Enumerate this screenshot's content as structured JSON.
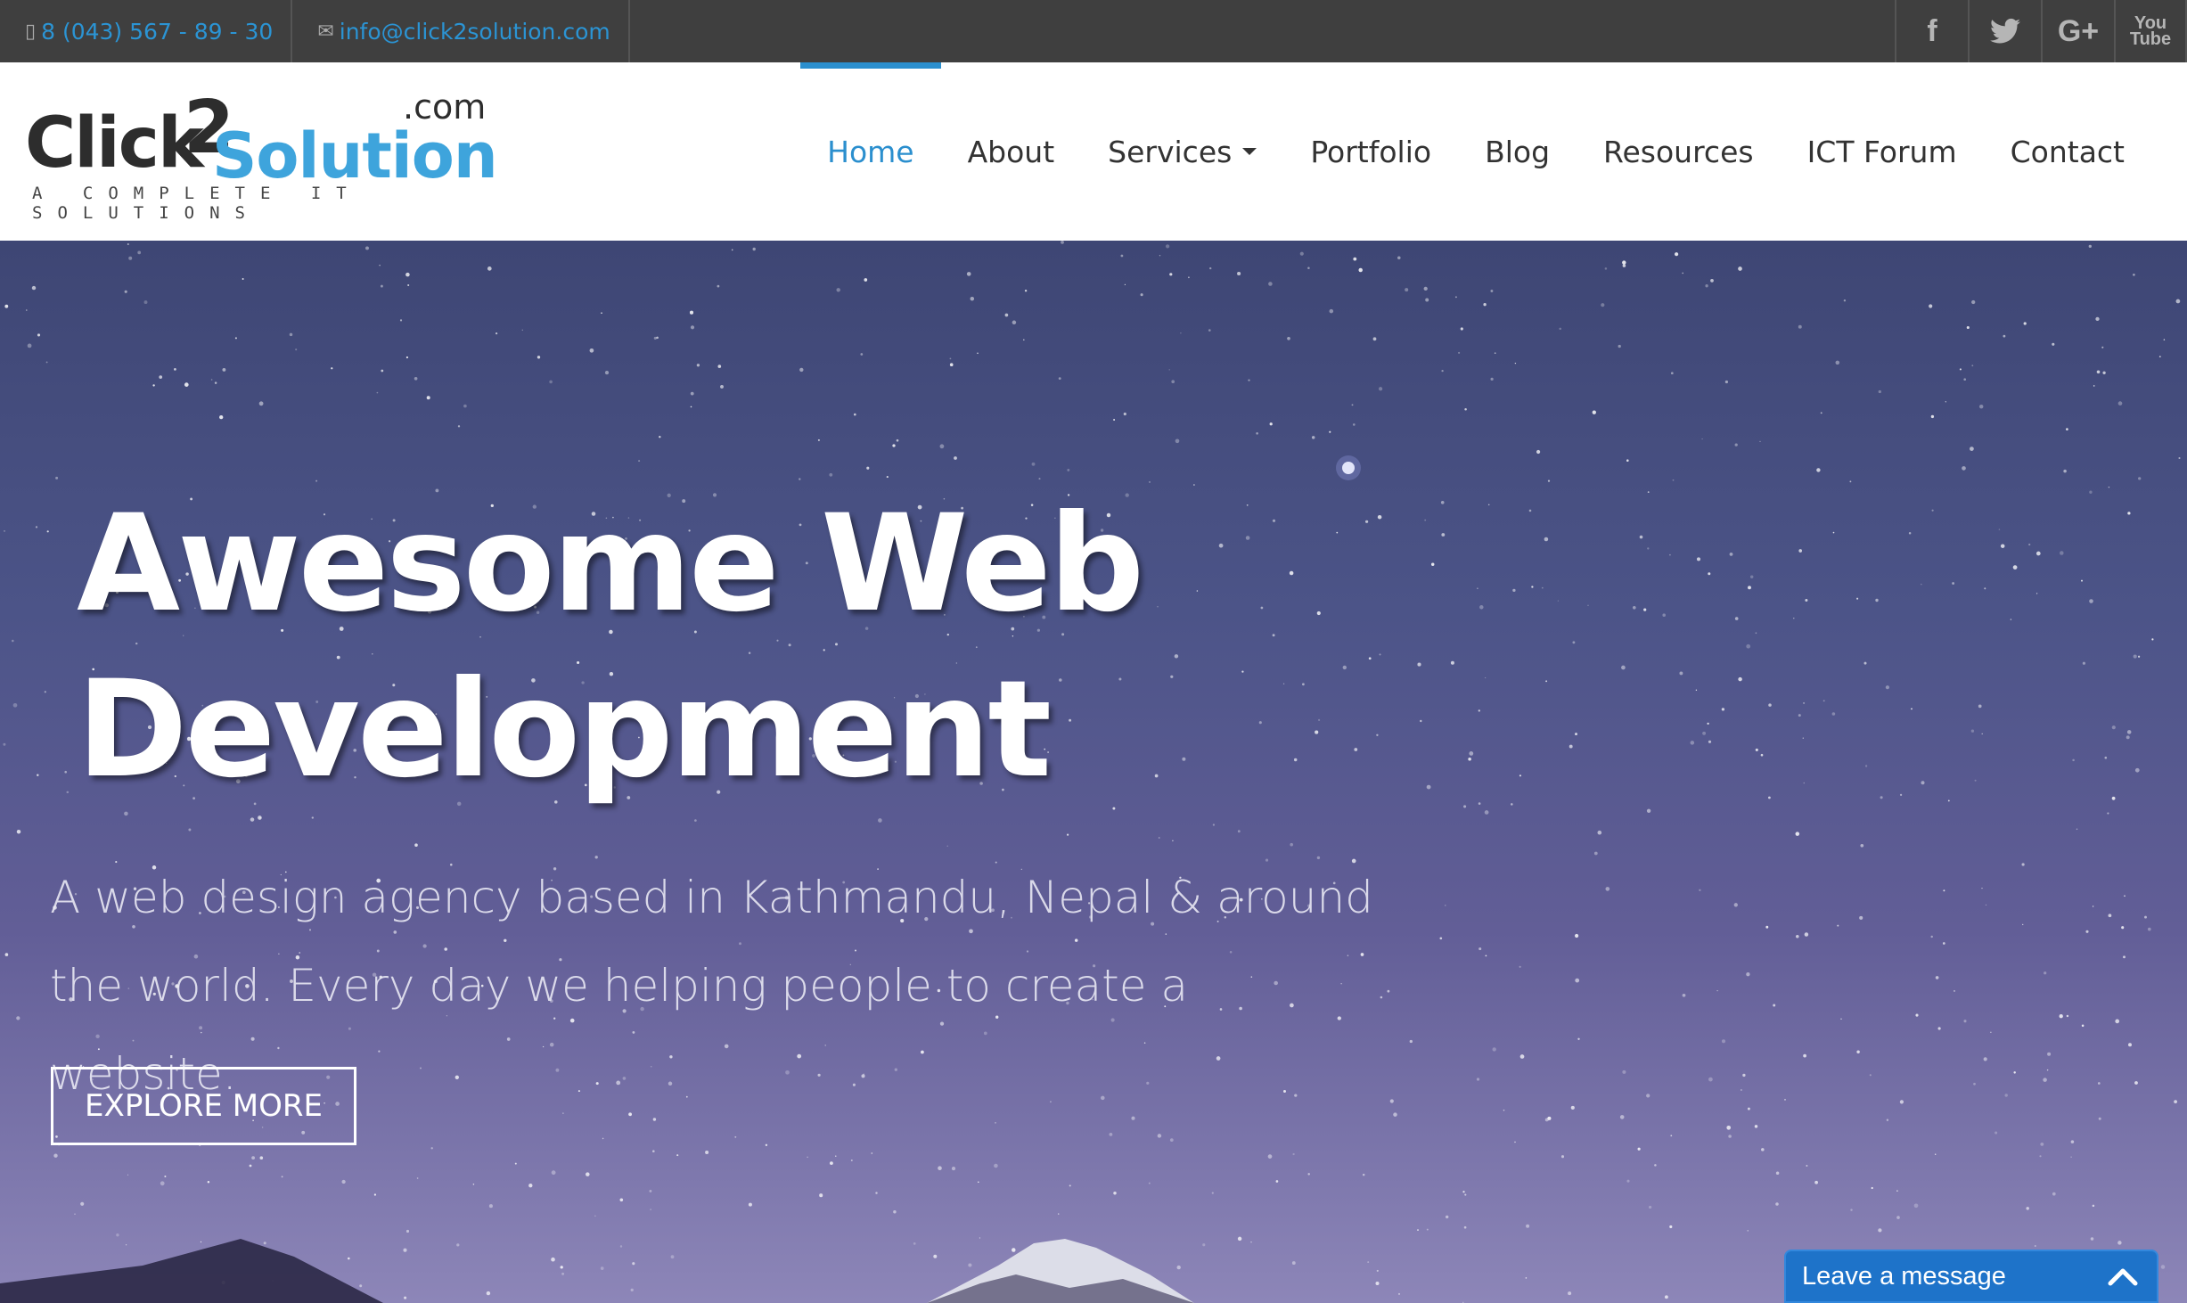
{
  "topbar": {
    "phone": "8 (043) 567 - 89 - 30",
    "email": "info@click2solution.com",
    "socials": [
      {
        "icon": "facebook-icon",
        "glyph": "f"
      },
      {
        "icon": "twitter-icon",
        "glyph": "🐦"
      },
      {
        "icon": "google-plus-icon",
        "glyph": "G+"
      },
      {
        "icon": "youtube-icon",
        "glyph": "▶"
      }
    ]
  },
  "logo": {
    "click": "Click",
    "two": "2",
    "solution": "Solution",
    "com": ".com",
    "tagline": "A COMPLETE IT SOLUTIONS"
  },
  "nav": {
    "items": [
      {
        "label": "Home",
        "active": true
      },
      {
        "label": "About"
      },
      {
        "label": "Services",
        "dropdown": true
      },
      {
        "label": "Portfolio"
      },
      {
        "label": "Blog"
      },
      {
        "label": "Resources"
      },
      {
        "label": "ICT Forum"
      },
      {
        "label": "Contact"
      }
    ],
    "accent": "#2b8fce"
  },
  "hero": {
    "title_line1": "Awesome Web",
    "title_line2": "Development",
    "subtitle_line1": "A web design agency based in Kathmandu, Nepal & around",
    "subtitle_line2": "the world. Every day we helping people to create a website.",
    "button": "EXPLORE MORE"
  },
  "chat": {
    "label": "Leave a message",
    "color": "#1e73c9"
  }
}
